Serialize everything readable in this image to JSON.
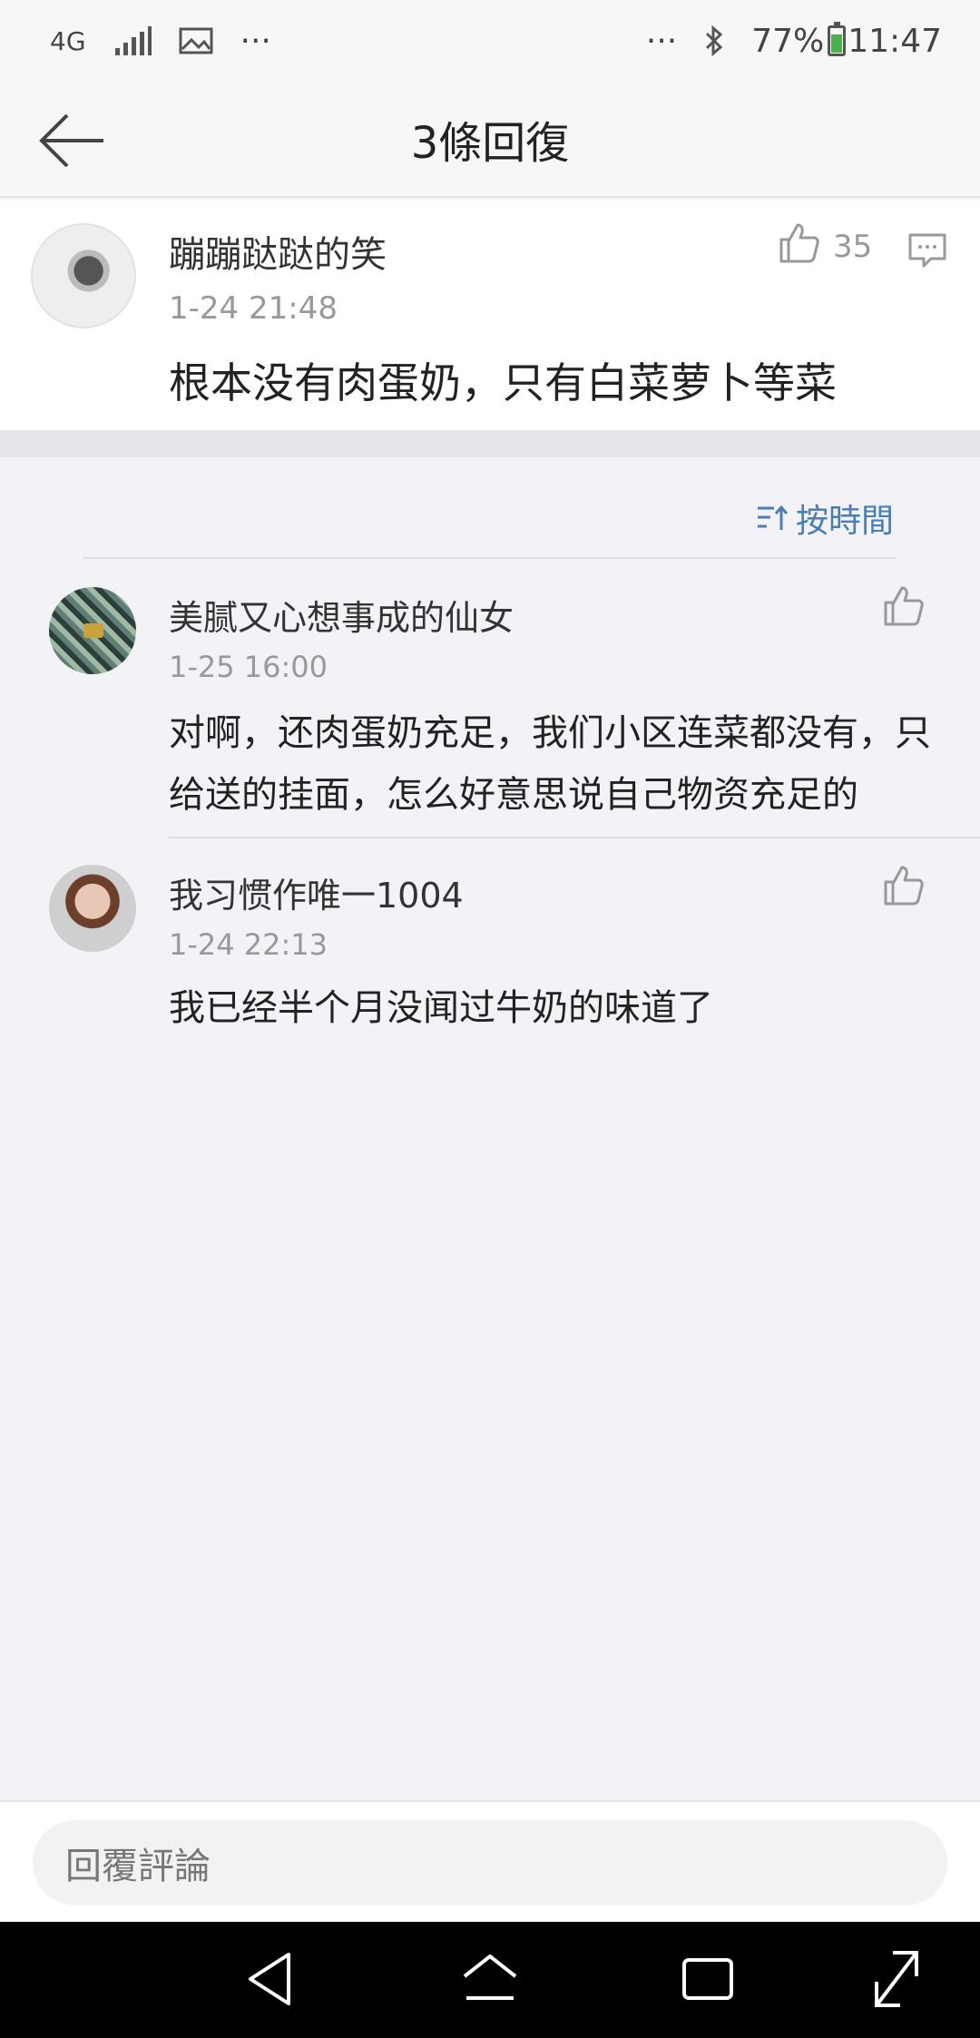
{
  "status_bar": {
    "network": "4G",
    "dots_left": "···",
    "dots_right": "···",
    "battery_percent": "77%",
    "time": "11:47",
    "battery_level": 0.77
  },
  "header": {
    "title": "3條回復"
  },
  "main_comment": {
    "username": "蹦蹦跶跶的笑",
    "timestamp": "1-24 21:48",
    "text": "根本没有肉蛋奶，只有白菜萝卜等菜",
    "like_count": "35"
  },
  "sort": {
    "label": "按時間"
  },
  "replies": [
    {
      "username": "美腻又心想事成的仙女",
      "timestamp": "1-25 16:00",
      "text": "对啊，还肉蛋奶充足，我们小区连菜都没有，只给送的挂面，怎么好意思说自己物资充足的"
    },
    {
      "username": "我习惯作唯一1004",
      "timestamp": "1-24 22:13",
      "text": "我已经半个月没闻过牛奶的味道了"
    }
  ],
  "reply_input": {
    "placeholder": "回覆評論"
  },
  "colors": {
    "accent": "#4a7eb5",
    "background": "#f2f2f7",
    "battery": "#4caf50"
  }
}
